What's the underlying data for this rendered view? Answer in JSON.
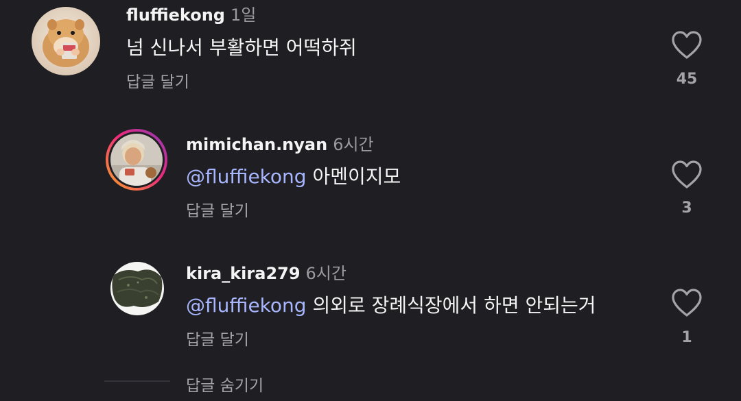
{
  "comments": [
    {
      "username": "fluffiekong",
      "time": "1일",
      "mention": "",
      "text": "넘 신나서 부활하면 어떡하쥐",
      "reply_label": "답글 달기",
      "likes": "45",
      "avatar_icon": "hamster-avatar"
    },
    {
      "username": "mimichan.nyan",
      "time": "6시간",
      "mention": "@fluffiekong",
      "text": "아멘이지모",
      "reply_label": "답글 달기",
      "likes": "3",
      "avatar_icon": "person-avatar-story-ring"
    },
    {
      "username": "kira_kira279",
      "time": "6시간",
      "mention": "@fluffiekong",
      "text": "의외로 장례식장에서 하면 안되는거",
      "reply_label": "답글 달기",
      "likes": "1",
      "avatar_icon": "seaweed-avatar"
    }
  ],
  "hide_replies_label": "답글 숨기기",
  "colors": {
    "background": "#1f1f23",
    "mention": "#a8b6ff",
    "muted": "#a3a3a8",
    "story_ring_start": "#f9a825",
    "story_ring_end": "#d6249f"
  }
}
